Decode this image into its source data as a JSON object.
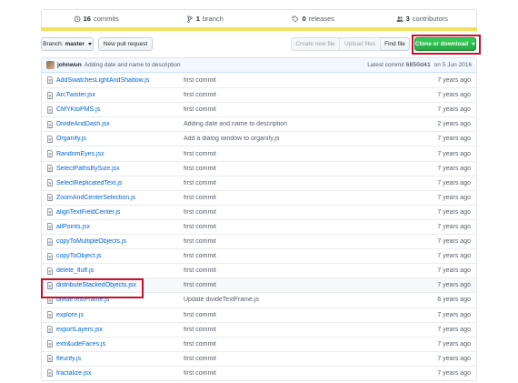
{
  "summary": {
    "commits_count": "16",
    "commits_label": "commits",
    "branch_count": "1",
    "branch_label": "branch",
    "releases_count": "0",
    "releases_label": "releases",
    "contributors_count": "3",
    "contributors_label": "contributors"
  },
  "language_bar_color": "#f1e05a",
  "toolbar": {
    "branch_prefix": "Branch:",
    "branch_name": "master",
    "new_pull_request": "New pull request",
    "create_new_file": "Create new file",
    "upload_files": "Upload files",
    "find_file": "Find file",
    "clone_or_download": "Clone or download"
  },
  "highlight_color": "#c8102e",
  "latest_commit": {
    "author": "johnwun",
    "message": "Adding date and name to description",
    "prefix": "Latest commit",
    "sha": "6850d41",
    "on": "on",
    "date": "5 Jun 2016"
  },
  "files": [
    {
      "name": "AddSwatchesLightAndShadow.js",
      "message": "first commit",
      "age": "7 years ago"
    },
    {
      "name": "ArcTwister.jsx",
      "message": "first commit",
      "age": "7 years ago"
    },
    {
      "name": "CMYKtoPMS.js",
      "message": "first commit",
      "age": "7 years ago"
    },
    {
      "name": "DivideAndDash.jsx",
      "message": "Adding date and name to description",
      "age": "2 years ago"
    },
    {
      "name": "Organify.js",
      "message": "Add a dialog window to organify.js",
      "age": "7 years ago"
    },
    {
      "name": "RandomEyes.jsx",
      "message": "first commit",
      "age": "7 years ago"
    },
    {
      "name": "SelectPathsBySize.jsx",
      "message": "first commit",
      "age": "7 years ago"
    },
    {
      "name": "SelectReplicatedText.js",
      "message": "first commit",
      "age": "7 years ago"
    },
    {
      "name": "ZoomAndCenterSelection.js",
      "message": "first commit",
      "age": "7 years ago"
    },
    {
      "name": "alignTextFieldCenter.js",
      "message": "first commit",
      "age": "7 years ago"
    },
    {
      "name": "allPoints.jsx",
      "message": "first commit",
      "age": "7 years ago"
    },
    {
      "name": "copyToMultipleObjects.js",
      "message": "first commit",
      "age": "7 years ago"
    },
    {
      "name": "copyToObject.js",
      "message": "first commit",
      "age": "7 years ago"
    },
    {
      "name": "delete_fluff.js",
      "message": "first commit",
      "age": "7 years ago"
    },
    {
      "name": "distributeStackedObjects.jsx",
      "message": "first commit",
      "age": "7 years ago"
    },
    {
      "name": "divideTextFrame.js",
      "message": "Update divideTextFrame.js",
      "age": "6 years ago"
    },
    {
      "name": "explore.js",
      "message": "first commit",
      "age": "7 years ago"
    },
    {
      "name": "exportLayers.jsx",
      "message": "first commit",
      "age": "7 years ago"
    },
    {
      "name": "extr&udeFaces.js",
      "message": "first commit",
      "age": "7 years ago"
    },
    {
      "name": "fleurify.js",
      "message": "first commit",
      "age": "7 years ago"
    },
    {
      "name": "fractalize.jsx",
      "message": "first commit",
      "age": "7 years ago"
    }
  ]
}
